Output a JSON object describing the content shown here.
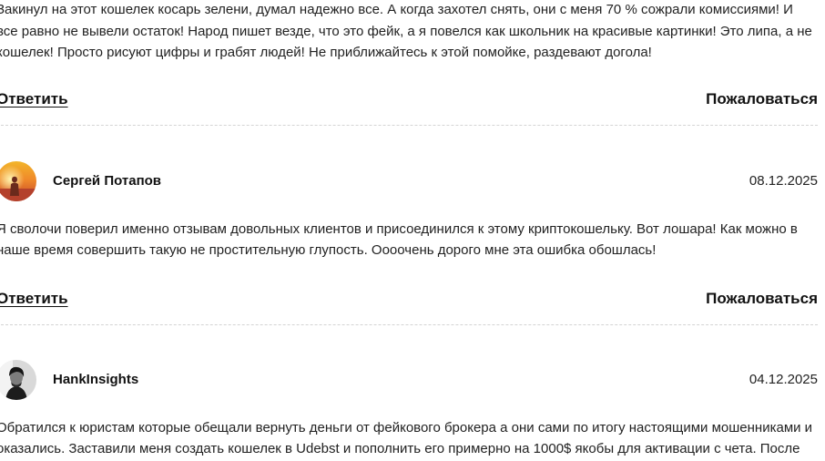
{
  "comments": [
    {
      "text": "Закинул на этот кошелек косарь зелени, думал надежно все. А когда захотел снять, они с меня 70 % сожрали комиссиями! И все равно не вывели остаток! Народ пишет везде, что это фейк, а я повелся как школьник на красивые картинки! Это липа, а не кошелек! Просто рисуют цифры и грабят людей! Не приближайтесь к этой помойке, раздевают догола!",
      "reply_label": "Ответить",
      "report_label": "Пожаловаться"
    },
    {
      "author": "Сергей Потапов",
      "date": "08.12.2025",
      "avatar_icon": "sunset-person-avatar",
      "text": "Я сволочи поверил именно отзывам довольных клиентов и присоединился к этому криптокошельку. Вот лошара! Как можно в наше время совершить такую не простительную глупость. Оооочень дорого мне эта ошибка обошлась!",
      "reply_label": "Ответить",
      "report_label": "Пожаловаться"
    },
    {
      "author": "HankInsights",
      "date": "04.12.2025",
      "avatar_icon": "bw-portrait-avatar",
      "text": "Обратился к юристам которые обещали вернуть деньги от фейкового брокера а они сами по итогу настоящими мошенниками и оказались. Заставили меня создать кошелек в Udebst и пополнить его примерно на 1000$ якобы для активации с чета. После пополнения в кошелке действительно появилась возвращенные средства но вывести ух ты не"
    }
  ]
}
